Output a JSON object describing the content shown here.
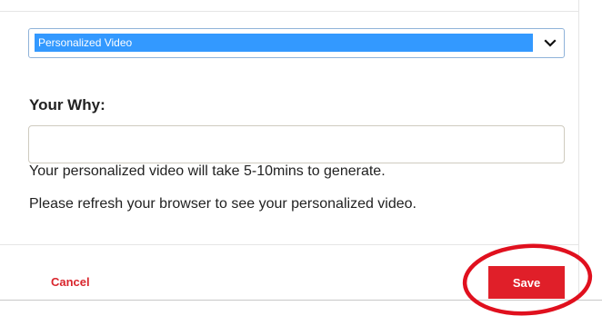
{
  "form": {
    "video_type_selected": "Personalized Video",
    "why_label": "Your Why:",
    "why_value": "",
    "info_line_1": "Your personalized video will take 5-10mins to generate.",
    "info_line_2": "Please refresh your browser to see your personalized video."
  },
  "actions": {
    "cancel_label": "Cancel",
    "save_label": "Save"
  },
  "colors": {
    "accent": "#e01f29",
    "select_highlight": "#3399ff",
    "annotation_circle": "#e0101e"
  },
  "icons": {
    "select_chevron": "chevron-down-icon"
  }
}
